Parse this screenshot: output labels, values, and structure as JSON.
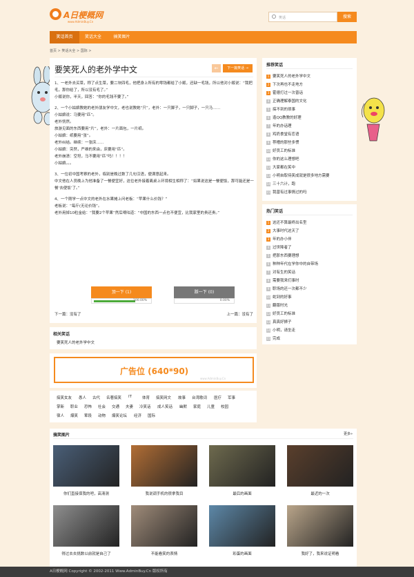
{
  "header": {
    "logo_text": "A日梗概网",
    "logo_sub": "www.AdminBuy.Cn",
    "search_placeholder": "笑话",
    "search_button": "搜索"
  },
  "nav": {
    "items": [
      {
        "label": "笑话首页"
      },
      {
        "label": "笑话大全"
      },
      {
        "label": "搞笑图片"
      }
    ]
  },
  "breadcrumb": "首页 > 笑话大全 > 国际 >",
  "article": {
    "title": "要笑死人的老外学中文",
    "prev": "←",
    "next": "下一篇笑话 →",
    "paragraphs": [
      "1、一老外去买菜，称了点生菜，要二块四毛，他把身上所有的零钱都给了小贩，还缺一毛钱，所以他对小贩说：“我把毛，那你给了，所以没有毛了。”\n小贩说你，半天，回答：“你的毛钱不要了。”",
      "2、一个小姑娘教她的老外朋友学中文，老也说教她“只”，老外：一只脚子，一只脚子，一只马……\n小姑娘说：马要用“匹”。\n老外恍然。\n旅游见面的东西要用“片”，老外：一片面包，一片纸。\n小姑娘：纸要用“张”。\n老外纠结。继续：一张床……\n小姑娘：突然，严维的来由，床要用“匹”。\n老外崩溃：空坦，马不要用“匹”吗！！！！\n小姑娘。。。",
      "3、一位初中国考察的老外，临别是晚过数了几句汉语，便满意起来。\n中文他在人员晚上为他准备了一餐便宜好，这位老外接着离桌上环境相生相称了：“如果说这是一餐便饭，那可能还是一餐‘去便饭’了。”",
      "4、一个刚学一点中文的老外在水果摊上问老板：“苹果什么价钱？”\n老板说：“每斤(无论价钱”。\n老外用掉10粒金给：“我要2个苹果”然后嘀咕道：“中国的东西一点也不便宜，比我家里的贵还贵。”"
    ],
    "vote_up_label": "顶一下 (1)",
    "vote_up_pct_text": "100.00%",
    "vote_up_fraction": 1.0,
    "vote_down_label": "踩一下 (0)",
    "vote_down_pct_text": "0.00%",
    "vote_down_fraction": 0.0,
    "prev_line": "下一篇：没有了",
    "next_line": "上一篇：没有了"
  },
  "related": {
    "heading": "相关笑话",
    "items": [
      "要笑死人的老外学中文"
    ]
  },
  "ad": {
    "text": "广告位 (640*90)",
    "watermark": "www.AdminBuy.Cn"
  },
  "tags": [
    "搞笑女友",
    "愚人",
    "古代",
    "名著搞笑",
    "IT",
    "体育",
    "搞笑网文",
    "故事",
    "台湾歌词",
    "医疗",
    "军事",
    "掌新",
    "职业",
    "恐怖",
    "社会",
    "交通",
    "夫妻",
    "冷笑话",
    "成人笑话",
    "幽默",
    "家庭",
    "儿童",
    "校园",
    "宿人",
    "爆笑",
    "荤段",
    "动物",
    "爆笑论坛",
    "经济",
    "国际"
  ],
  "sidebar_recommend": {
    "heading": "推荐笑话",
    "items": [
      "要笑死人的老外学中文",
      "下次再也不走地方",
      "霍德打过一次普话",
      "正确理解泰国的文化",
      "搞不到的琐事",
      "造QQ教教的好理",
      "年的办话理",
      "鸡奶食堂有恋语",
      "荐槽的那些多惯",
      "好员工的标准",
      "你的这么理想吧",
      "大家都在笑中",
      "小明自取待笑成就是很多地方需要",
      "三十六计，跑",
      "我曾有过事情过的吗"
    ]
  },
  "sidebar_hot": {
    "heading": "热门笑话",
    "items": [
      "这还不算最终出名型",
      "大事时代这天了",
      "年的办小伴",
      "过世降者了",
      "把那东西要理想",
      "种种年代在学你中的自带场",
      "对有生的笑话",
      "需要我来们事时",
      "职场的还一次都不少",
      "蛇到的好事",
      "翻版时光",
      "好员工的标准",
      "真真好狮子",
      "小明，请坐走",
      "完成"
    ]
  },
  "gallery": {
    "heading": "搞笑图片",
    "more": "更多»",
    "items": [
      {
        "caption": "你们直接保我的吧，高清测",
        "color": "#4a5f78"
      },
      {
        "caption": "我说调手机的很拿我目",
        "color": "#b26e35"
      },
      {
        "caption": "最后的画面",
        "color": "#6e6a4e"
      },
      {
        "caption": "最近的一次",
        "color": "#5a3f2c"
      },
      {
        "caption": "得过去去挑数以前就是自己了",
        "color": "#8f8f8f"
      },
      {
        "caption": "不能看笑的表情",
        "color": "#a08c7a"
      },
      {
        "caption": "彩蛋的画面",
        "color": "#5d88a8"
      },
      {
        "caption": "我好了，我来说证明看",
        "color": "#b9a58a"
      }
    ]
  },
  "footer": "A日梗概网 Copyright © 2002-2011 Www.AdminBuy.Cn 版权所有"
}
